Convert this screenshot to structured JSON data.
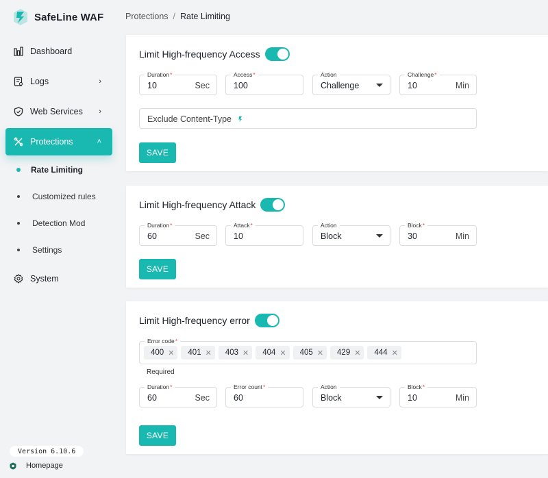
{
  "brand": {
    "name": "SafeLine WAF"
  },
  "sidebar": {
    "items": [
      {
        "label": "Dashboard",
        "icon": "bar-chart-icon"
      },
      {
        "label": "Logs",
        "icon": "log-icon"
      },
      {
        "label": "Web Services",
        "icon": "shield-icon"
      },
      {
        "label": "Protections",
        "icon": "tools-icon"
      },
      {
        "label": "System",
        "icon": "gear-icon"
      }
    ],
    "sub_items": [
      {
        "label": "Rate Limiting"
      },
      {
        "label": "Customized rules"
      },
      {
        "label": "Detection Mod"
      },
      {
        "label": "Settings"
      }
    ],
    "version": "Version 6.10.6",
    "homepage": "Homepage"
  },
  "breadcrumb": {
    "parent": "Protections",
    "separator": "/",
    "current": "Rate Limiting"
  },
  "accent_color": "#19b9b1",
  "cards": {
    "access": {
      "title": "Limit High-frequency Access",
      "enabled": true,
      "fields": {
        "duration": {
          "label": "Duration",
          "value": "10",
          "unit": "Sec"
        },
        "access": {
          "label": "Access",
          "value": "100"
        },
        "action": {
          "label": "Action",
          "value": "Challenge"
        },
        "challenge": {
          "label": "Challenge",
          "value": "10",
          "unit": "Min"
        }
      },
      "exclude_placeholder": "Exclude Content-Type",
      "save": "SAVE"
    },
    "attack": {
      "title": "Limit High-frequency Attack",
      "enabled": true,
      "fields": {
        "duration": {
          "label": "Duration",
          "value": "60",
          "unit": "Sec"
        },
        "attack": {
          "label": "Attack",
          "value": "10"
        },
        "action": {
          "label": "Action",
          "value": "Block"
        },
        "block": {
          "label": "Block",
          "value": "30",
          "unit": "Min"
        }
      },
      "save": "SAVE"
    },
    "error": {
      "title": "Limit High-frequency error",
      "enabled": true,
      "error_code_label": "Error code",
      "error_codes": [
        "400",
        "401",
        "403",
        "404",
        "405",
        "429",
        "444"
      ],
      "helper": "Required",
      "fields": {
        "duration": {
          "label": "Duration",
          "value": "60",
          "unit": "Sec"
        },
        "error_count": {
          "label": "Error count",
          "value": "60"
        },
        "action": {
          "label": "Action",
          "value": "Block"
        },
        "block": {
          "label": "Block",
          "value": "10",
          "unit": "Min"
        }
      },
      "save": "SAVE"
    }
  }
}
